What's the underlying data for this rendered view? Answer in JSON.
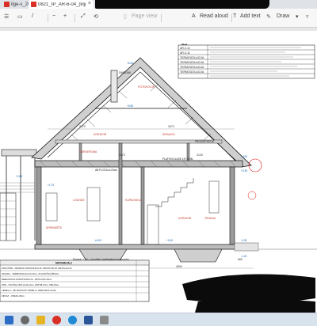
{
  "browser": {
    "tabs": [
      {
        "title": "ilge-s_2022...",
        "active": false
      },
      {
        "title": "0821_IP_AR-6-04_(kljge-b_2022...",
        "active": true
      }
    ],
    "new_tab": "+"
  },
  "pdf_toolbar": {
    "page_view": "Page view",
    "read_aloud": "Read aloud",
    "add_text": "Add text",
    "draw": "Draw"
  },
  "drawing": {
    "sheet_code": "P3",
    "legend_rows": [
      "AR-0-11",
      "AR-0-11",
      "TERMOIZOLACIJA",
      "TERMOIZOLACIJA",
      "TERMOIZOLACIJA",
      "TERMOIZOLACIJA"
    ],
    "room_labels": {
      "attic_top": "POTKROVJE",
      "corridor_upper": "KORIDOR",
      "bedroom_upper": "SPAVAĆA",
      "living_room": "LOUNGE",
      "bathroom": "KUPAONICA",
      "corridor_lower": "KORIDOR",
      "terrace": "TERASA",
      "storage": "SPREMIŠTE",
      "wardrobe": "GARDEROBA"
    },
    "dimensions": [
      "3470",
      "3473",
      "3473",
      "3130",
      "4500",
      "4500",
      "1250",
      "660",
      "4850"
    ],
    "levels": [
      "+6.30",
      "+5.55",
      "+4.50",
      "+3.35",
      "+2.85",
      "+0.00",
      "-0.30",
      "-1.20",
      "+1.70",
      "±0.00"
    ],
    "notes": {
      "section_note": "Presjek: 1:50 — krovište i međukatna konstrukcija",
      "chimney": "DIMNJAK",
      "window_note": "PROZOR 95/140",
      "slab_note": "AB PLOČA d=20cm",
      "ceiling_note": "PLAFON KLASE 15+15 ML"
    },
    "title_block": {
      "header": "MATERIJALI",
      "rows": [
        "KROVIŠTE - DRVENA KONSTRUKCIJA; PROSTOR ZA VENTILACIJU",
        "FASADA - TERMOIZOLACIJA 10cm, PLASTIČNA ŽBUKA",
        "MEĐUKATNA KONSTRUKCIJA - AB PLOČA 20cm",
        "POD - ZVUČNA IZOLACIJA 4cm, ESTRIH 5cm, OBLOGA",
        "TEMELJI - AB TRAKASTI TEMELJI; HIDROIZOLACIJA",
        "ZIDOVI - OPEKA 25cm"
      ]
    }
  },
  "taskbar": {
    "icons": [
      "windows-logo",
      "search",
      "file-explorer",
      "chrome",
      "edge",
      "word",
      "settings"
    ]
  }
}
